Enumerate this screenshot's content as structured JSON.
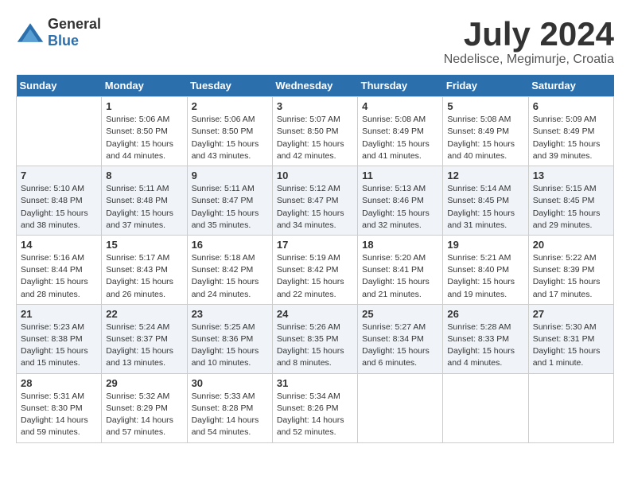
{
  "logo": {
    "general": "General",
    "blue": "Blue"
  },
  "title": "July 2024",
  "location": "Nedelisce, Megimurje, Croatia",
  "days_of_week": [
    "Sunday",
    "Monday",
    "Tuesday",
    "Wednesday",
    "Thursday",
    "Friday",
    "Saturday"
  ],
  "weeks": [
    [
      {
        "day": "",
        "info": ""
      },
      {
        "day": "1",
        "info": "Sunrise: 5:06 AM\nSunset: 8:50 PM\nDaylight: 15 hours\nand 44 minutes."
      },
      {
        "day": "2",
        "info": "Sunrise: 5:06 AM\nSunset: 8:50 PM\nDaylight: 15 hours\nand 43 minutes."
      },
      {
        "day": "3",
        "info": "Sunrise: 5:07 AM\nSunset: 8:50 PM\nDaylight: 15 hours\nand 42 minutes."
      },
      {
        "day": "4",
        "info": "Sunrise: 5:08 AM\nSunset: 8:49 PM\nDaylight: 15 hours\nand 41 minutes."
      },
      {
        "day": "5",
        "info": "Sunrise: 5:08 AM\nSunset: 8:49 PM\nDaylight: 15 hours\nand 40 minutes."
      },
      {
        "day": "6",
        "info": "Sunrise: 5:09 AM\nSunset: 8:49 PM\nDaylight: 15 hours\nand 39 minutes."
      }
    ],
    [
      {
        "day": "7",
        "info": ""
      },
      {
        "day": "8",
        "info": "Sunrise: 5:11 AM\nSunset: 8:48 PM\nDaylight: 15 hours\nand 37 minutes."
      },
      {
        "day": "9",
        "info": "Sunrise: 5:11 AM\nSunset: 8:47 PM\nDaylight: 15 hours\nand 35 minutes."
      },
      {
        "day": "10",
        "info": "Sunrise: 5:12 AM\nSunset: 8:47 PM\nDaylight: 15 hours\nand 34 minutes."
      },
      {
        "day": "11",
        "info": "Sunrise: 5:13 AM\nSunset: 8:46 PM\nDaylight: 15 hours\nand 32 minutes."
      },
      {
        "day": "12",
        "info": "Sunrise: 5:14 AM\nSunset: 8:45 PM\nDaylight: 15 hours\nand 31 minutes."
      },
      {
        "day": "13",
        "info": "Sunrise: 5:15 AM\nSunset: 8:45 PM\nDaylight: 15 hours\nand 29 minutes."
      }
    ],
    [
      {
        "day": "14",
        "info": ""
      },
      {
        "day": "15",
        "info": "Sunrise: 5:17 AM\nSunset: 8:43 PM\nDaylight: 15 hours\nand 26 minutes."
      },
      {
        "day": "16",
        "info": "Sunrise: 5:18 AM\nSunset: 8:42 PM\nDaylight: 15 hours\nand 24 minutes."
      },
      {
        "day": "17",
        "info": "Sunrise: 5:19 AM\nSunset: 8:42 PM\nDaylight: 15 hours\nand 22 minutes."
      },
      {
        "day": "18",
        "info": "Sunrise: 5:20 AM\nSunset: 8:41 PM\nDaylight: 15 hours\nand 21 minutes."
      },
      {
        "day": "19",
        "info": "Sunrise: 5:21 AM\nSunset: 8:40 PM\nDaylight: 15 hours\nand 19 minutes."
      },
      {
        "day": "20",
        "info": "Sunrise: 5:22 AM\nSunset: 8:39 PM\nDaylight: 15 hours\nand 17 minutes."
      }
    ],
    [
      {
        "day": "21",
        "info": ""
      },
      {
        "day": "22",
        "info": "Sunrise: 5:24 AM\nSunset: 8:37 PM\nDaylight: 15 hours\nand 13 minutes."
      },
      {
        "day": "23",
        "info": "Sunrise: 5:25 AM\nSunset: 8:36 PM\nDaylight: 15 hours\nand 10 minutes."
      },
      {
        "day": "24",
        "info": "Sunrise: 5:26 AM\nSunset: 8:35 PM\nDaylight: 15 hours\nand 8 minutes."
      },
      {
        "day": "25",
        "info": "Sunrise: 5:27 AM\nSunset: 8:34 PM\nDaylight: 15 hours\nand 6 minutes."
      },
      {
        "day": "26",
        "info": "Sunrise: 5:28 AM\nSunset: 8:33 PM\nDaylight: 15 hours\nand 4 minutes."
      },
      {
        "day": "27",
        "info": "Sunrise: 5:30 AM\nSunset: 8:31 PM\nDaylight: 15 hours\nand 1 minute."
      }
    ],
    [
      {
        "day": "28",
        "info": "Sunrise: 5:31 AM\nSunset: 8:30 PM\nDaylight: 14 hours\nand 59 minutes."
      },
      {
        "day": "29",
        "info": "Sunrise: 5:32 AM\nSunset: 8:29 PM\nDaylight: 14 hours\nand 57 minutes."
      },
      {
        "day": "30",
        "info": "Sunrise: 5:33 AM\nSunset: 8:28 PM\nDaylight: 14 hours\nand 54 minutes."
      },
      {
        "day": "31",
        "info": "Sunrise: 5:34 AM\nSunset: 8:26 PM\nDaylight: 14 hours\nand 52 minutes."
      },
      {
        "day": "",
        "info": ""
      },
      {
        "day": "",
        "info": ""
      },
      {
        "day": "",
        "info": ""
      }
    ]
  ],
  "week7_sun_info": "Sunrise: 5:10 AM\nSunset: 8:48 PM\nDaylight: 15 hours\nand 38 minutes.",
  "week14_sun_info": "Sunrise: 5:16 AM\nSunset: 8:44 PM\nDaylight: 15 hours\nand 28 minutes.",
  "week21_sun_info": "Sunrise: 5:23 AM\nSunset: 8:38 PM\nDaylight: 15 hours\nand 15 minutes."
}
